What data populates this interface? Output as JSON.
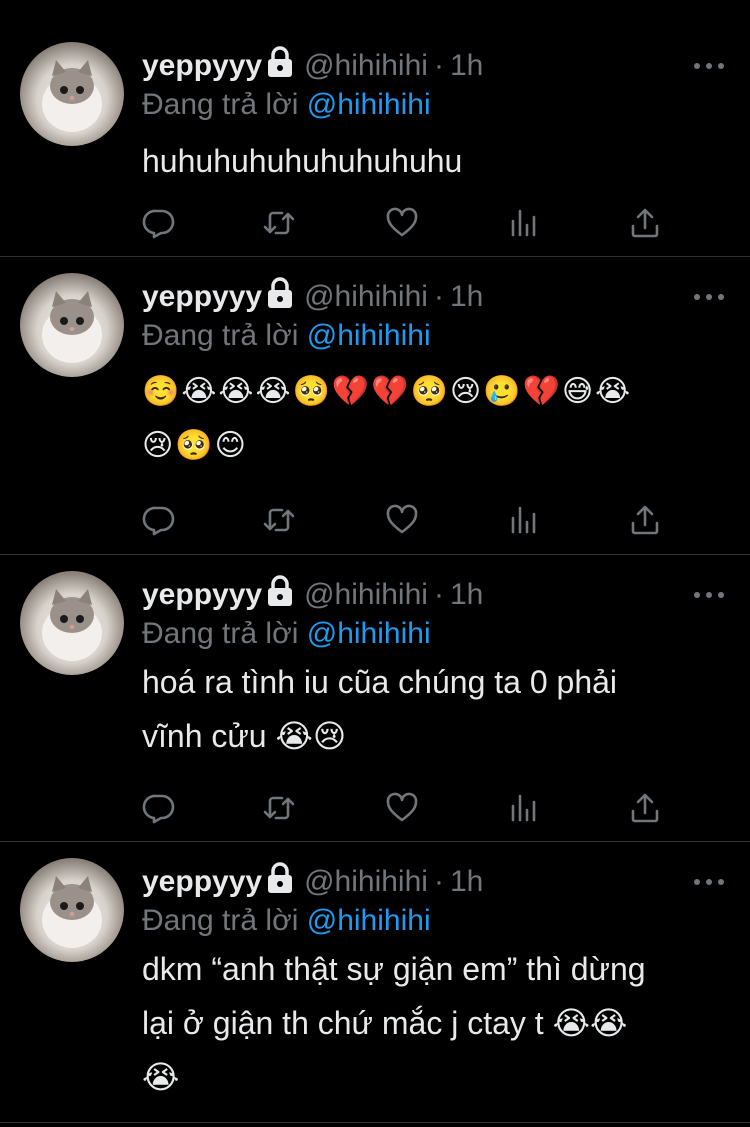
{
  "tweets": [
    {
      "name": "yeppyyy",
      "handle": "@hihihihi",
      "time": "1h",
      "reply_prefix": "Đang trả lời",
      "reply_to": "@hihihihi",
      "text": "huhuhuhuhuhuhuhuhu"
    },
    {
      "name": "yeppyyy",
      "handle": "@hihihihi",
      "time": "1h",
      "reply_prefix": "Đang trả lời",
      "reply_to": "@hihihihi",
      "text": "☺️😭😭😭🥺💔💔🥺😢🥲💔😅😭\n😢🥺😊"
    },
    {
      "name": "yeppyyy",
      "handle": "@hihihihi",
      "time": "1h",
      "reply_prefix": "Đang trả lời",
      "reply_to": "@hihihihi",
      "text": "hoá ra tình iu cũa chúng ta 0 phải\nvĩnh cửu 😭😢"
    },
    {
      "name": "yeppyyy",
      "handle": "@hihihihi",
      "time": "1h",
      "reply_prefix": "Đang trả lời",
      "reply_to": "@hihihihi",
      "text": "dkm “anh thật sự giận em” thì dừng\nlại ở giận th chứ mắc j ctay t 😭😭\n😭"
    }
  ],
  "icons": {
    "lock": "lock-icon",
    "more": "more-icon",
    "reply": "reply-icon",
    "retweet": "retweet-icon",
    "like": "heart-icon",
    "views": "views-icon",
    "share": "share-icon"
  },
  "colors": {
    "background": "#000000",
    "text": "#e7e9ea",
    "muted": "#71767b",
    "link": "#1d9bf0",
    "divider": "#2f3336"
  }
}
